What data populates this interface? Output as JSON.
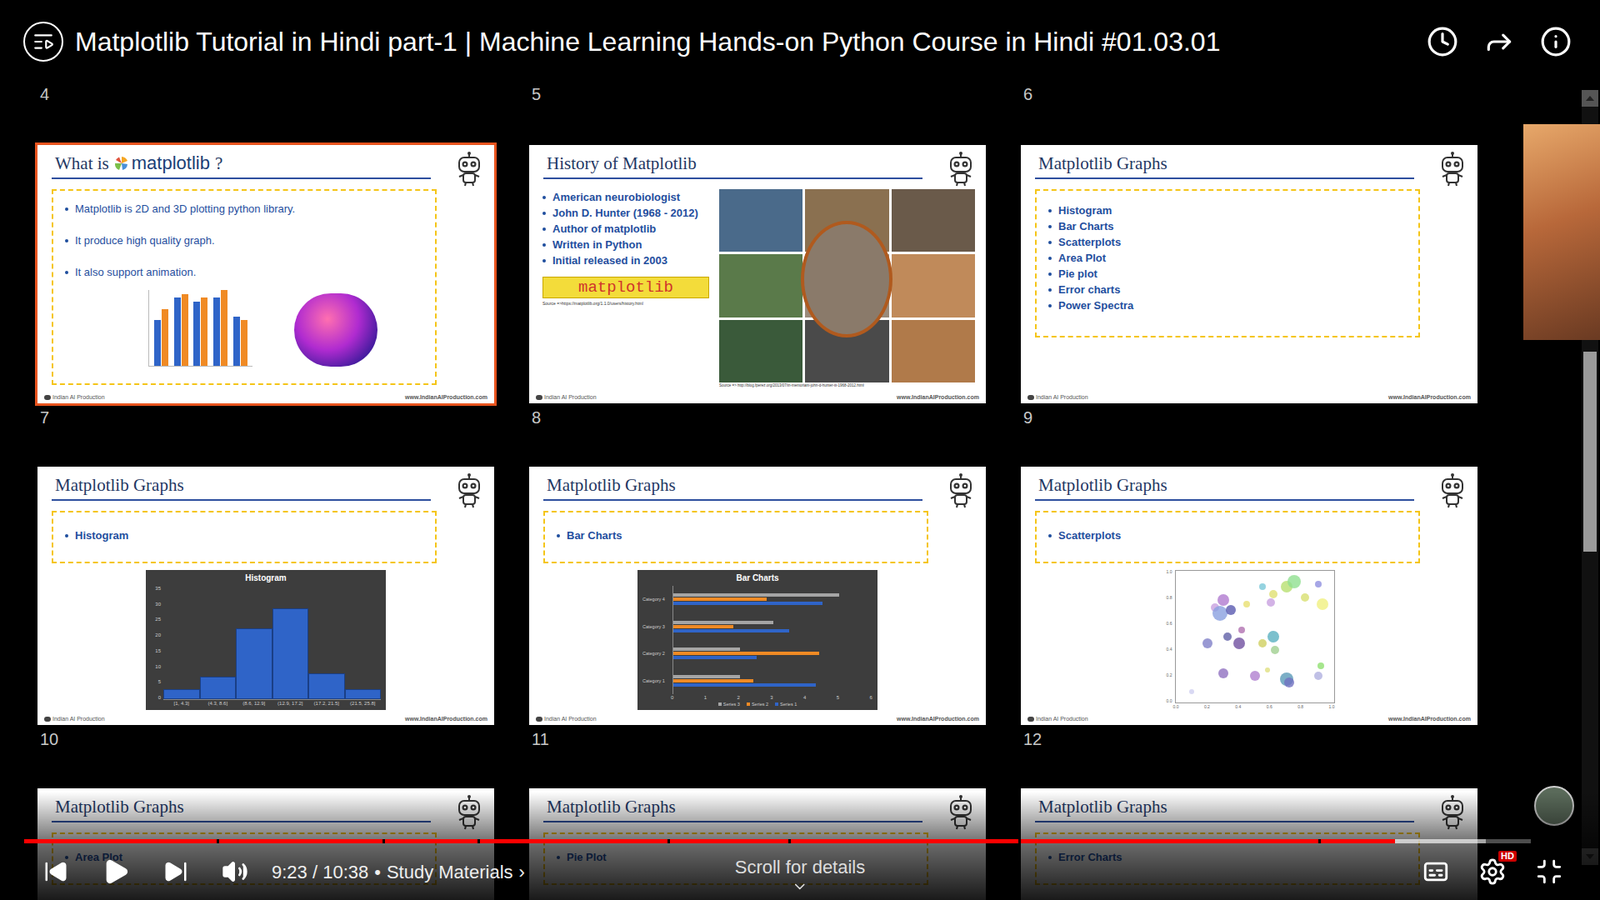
{
  "player": {
    "title": "Matplotlib Tutorial in Hindi part-1 | Machine Learning Hands-on Python Course in Hindi #01.03.01",
    "time": "9:23 / 10:38",
    "separator": "•",
    "chapter": "Study Materials",
    "chapter_arrow": "›",
    "scroll_hint": "Scroll for details",
    "quality_badge": "HD",
    "playing": false,
    "progress": {
      "level": 0.91,
      "buffered": 0.97,
      "chapter_marks": [
        0.128,
        0.238,
        0.301,
        0.427,
        0.507,
        0.66,
        0.859
      ]
    },
    "scroll": {
      "level": 0.33,
      "thumb": 0.27
    }
  },
  "slide_footer": {
    "left": "Indian AI Production",
    "right": "www.IndianAIProduction.com"
  },
  "sorter": {
    "top_numbers": [
      "4",
      "5",
      "6"
    ],
    "rows": [
      {
        "numbers": [
          "7",
          "8",
          "9"
        ],
        "slides": [
          {
            "kind": "intro",
            "selected": true,
            "title": "What is",
            "logo": "matplotlib",
            "title_end": "?",
            "bullets": [
              "Matplotlib is 2D and 3D plotting python library.",
              "It produce high quality graph.",
              "It also support animation."
            ],
            "mini_chart": {
              "series": [
                {
                  "color": "#2f64c8",
                  "values": [
                    0.6,
                    0.9,
                    0.85,
                    0.9,
                    0.65
                  ]
                },
                {
                  "color": "#f08a24",
                  "values": [
                    0.75,
                    0.95,
                    0.9,
                    1.0,
                    0.6
                  ]
                }
              ]
            }
          },
          {
            "kind": "history",
            "selected": false,
            "title": "History of Matplotlib",
            "bullets": [
              "American neurobiologist",
              "John D. Hunter (1968 - 2012)",
              "Author of matplotlib",
              "Written in Python",
              "Initial released in 2003"
            ],
            "logo": "matplotlib",
            "logo_source": "Source =>https://matplotlib.org/1.1.0/users/history.html",
            "photo_source": "Source => http://blog.fperez.org/2013/07/in-memoriam-john-d-hunter-iii-1968-2012.html"
          },
          {
            "kind": "list",
            "selected": false,
            "title": "Matplotlib Graphs",
            "bullets": [
              "Histogram",
              "Bar Charts",
              "Scatterplots",
              "Area Plot",
              "Pie plot",
              "Error charts",
              "Power Spectra"
            ]
          }
        ]
      },
      {
        "numbers": [
          "10",
          "11",
          "12"
        ],
        "slides": [
          {
            "kind": "histogram",
            "selected": false,
            "title": "Matplotlib Graphs",
            "bullets": [
              "Histogram"
            ],
            "chart": {
              "title": "Histogram",
              "y_ticks": [
                "0",
                "5",
                "10",
                "15",
                "20",
                "25",
                "30",
                "35"
              ],
              "x_labels": [
                "[1, 4.3]",
                "(4.3, 8.6]",
                "(8.6, 12.9]",
                "(12.9, 17.2]",
                "(17.2, 21.5]",
                "(21.5, 25.8]"
              ],
              "values": [
                3,
                7,
                22,
                28,
                8,
                3
              ]
            }
          },
          {
            "kind": "bars",
            "selected": false,
            "title": "Matplotlib Graphs",
            "bullets": [
              "Bar Charts"
            ],
            "chart": {
              "title": "Bar Charts",
              "categories": [
                "Category 1",
                "Category 2",
                "Category 3",
                "Category 4"
              ],
              "x_ticks": [
                "0",
                "1",
                "2",
                "3",
                "4",
                "5",
                "6"
              ],
              "series": [
                {
                  "name": "Series 1",
                  "color": "#2f64c8",
                  "values": [
                    4.3,
                    2.5,
                    3.5,
                    4.5
                  ]
                },
                {
                  "name": "Series 2",
                  "color": "#f08a24",
                  "values": [
                    2.4,
                    4.4,
                    1.8,
                    2.8
                  ]
                },
                {
                  "name": "Series 3",
                  "color": "#a5a5a5",
                  "values": [
                    2,
                    2,
                    3,
                    5
                  ]
                }
              ]
            }
          },
          {
            "kind": "scatter",
            "selected": false,
            "title": "Matplotlib Graphs",
            "bullets": [
              "Scatterplots"
            ],
            "chart": {
              "x_ticks": [
                "0.0",
                "0.2",
                "0.4",
                "0.6",
                "0.8",
                "1.0"
              ],
              "y_ticks": [
                "0.0",
                "0.2",
                "0.4",
                "0.6",
                "0.8",
                "1.0"
              ],
              "points": [
                {
                  "x": 0.3,
                  "y": 0.78,
                  "size": 14,
                  "color": "#b07ad0"
                },
                {
                  "x": 0.25,
                  "y": 0.72,
                  "size": 10,
                  "color": "#c8a0e0"
                },
                {
                  "x": 0.28,
                  "y": 0.68,
                  "size": 18,
                  "color": "#8aa0e0"
                },
                {
                  "x": 0.35,
                  "y": 0.7,
                  "size": 12,
                  "color": "#5a5ab0"
                },
                {
                  "x": 0.45,
                  "y": 0.75,
                  "size": 8,
                  "color": "#e8e070"
                },
                {
                  "x": 0.55,
                  "y": 0.88,
                  "size": 8,
                  "color": "#7ac8d8"
                },
                {
                  "x": 0.62,
                  "y": 0.82,
                  "size": 10,
                  "color": "#e0e070"
                },
                {
                  "x": 0.7,
                  "y": 0.88,
                  "size": 14,
                  "color": "#b8e070"
                },
                {
                  "x": 0.75,
                  "y": 0.92,
                  "size": 16,
                  "color": "#90e090"
                },
                {
                  "x": 0.82,
                  "y": 0.8,
                  "size": 10,
                  "color": "#d8e070"
                },
                {
                  "x": 0.93,
                  "y": 0.75,
                  "size": 14,
                  "color": "#f0f080"
                },
                {
                  "x": 0.9,
                  "y": 0.9,
                  "size": 8,
                  "color": "#9090e0"
                },
                {
                  "x": 0.6,
                  "y": 0.76,
                  "size": 10,
                  "color": "#c8a0e0"
                },
                {
                  "x": 0.2,
                  "y": 0.45,
                  "size": 12,
                  "color": "#8080c8"
                },
                {
                  "x": 0.33,
                  "y": 0.5,
                  "size": 10,
                  "color": "#6060a8"
                },
                {
                  "x": 0.4,
                  "y": 0.45,
                  "size": 14,
                  "color": "#7050a0"
                },
                {
                  "x": 0.42,
                  "y": 0.55,
                  "size": 8,
                  "color": "#b070b0"
                },
                {
                  "x": 0.55,
                  "y": 0.45,
                  "size": 10,
                  "color": "#d0d060"
                },
                {
                  "x": 0.62,
                  "y": 0.5,
                  "size": 14,
                  "color": "#5ab0c0"
                },
                {
                  "x": 0.63,
                  "y": 0.4,
                  "size": 10,
                  "color": "#a0d090"
                },
                {
                  "x": 0.3,
                  "y": 0.22,
                  "size": 12,
                  "color": "#9070c0"
                },
                {
                  "x": 0.5,
                  "y": 0.2,
                  "size": 12,
                  "color": "#b080d0"
                },
                {
                  "x": 0.7,
                  "y": 0.18,
                  "size": 16,
                  "color": "#5a9ab8"
                },
                {
                  "x": 0.72,
                  "y": 0.15,
                  "size": 12,
                  "color": "#7070c0"
                },
                {
                  "x": 0.9,
                  "y": 0.2,
                  "size": 10,
                  "color": "#b0b0e0"
                },
                {
                  "x": 0.92,
                  "y": 0.28,
                  "size": 8,
                  "color": "#90e070"
                },
                {
                  "x": 0.58,
                  "y": 0.25,
                  "size": 6,
                  "color": "#e0e080"
                },
                {
                  "x": 0.1,
                  "y": 0.08,
                  "size": 6,
                  "color": "#d0d0f0"
                }
              ]
            }
          }
        ]
      },
      {
        "slides": [
          {
            "kind": "partial",
            "selected": false,
            "title": "Matplotlib Graphs",
            "bullets": [
              "Area Plot"
            ]
          },
          {
            "kind": "partial",
            "selected": false,
            "title": "Matplotlib Graphs",
            "bullets": [
              "Pie Plot"
            ]
          },
          {
            "kind": "partial",
            "selected": false,
            "title": "Matplotlib Graphs",
            "bullets": [
              "Error Charts"
            ]
          }
        ]
      }
    ]
  }
}
